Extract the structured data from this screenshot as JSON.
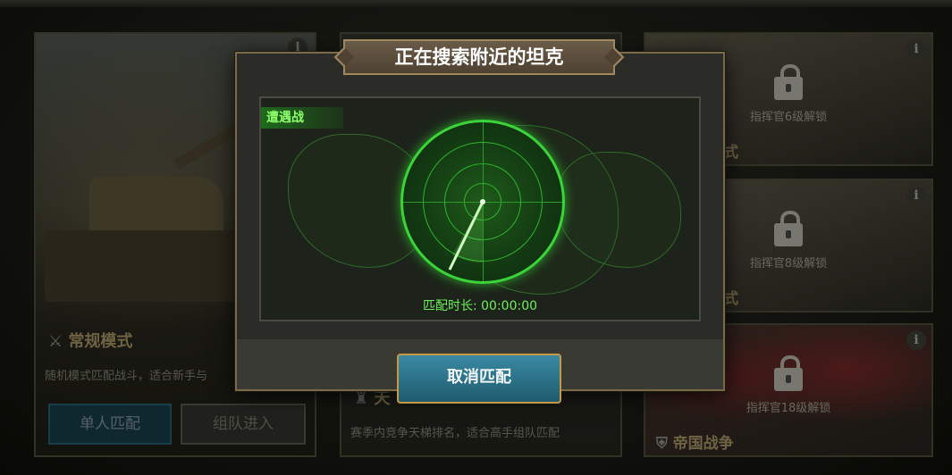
{
  "dialog": {
    "title": "正在搜索附近的坦克",
    "mode_tag": "遭遇战",
    "match_time": "匹配时长: 00:00:00",
    "cancel_label": "取消匹配"
  },
  "cards": {
    "left": {
      "title": "常规模式",
      "desc": "随机模式匹配战斗，适合新手与",
      "solo_label": "单人匹配",
      "team_label": "组队进入"
    },
    "middle": {
      "title": "天",
      "desc": "赛季内竞争天梯排名，适合高手组队匹配"
    },
    "right": [
      {
        "lock_text": "指挥官6级解锁",
        "title": "模式"
      },
      {
        "lock_text": "指挥官8级解锁",
        "title": "模式"
      },
      {
        "lock_text": "指挥官18级解锁",
        "title": "帝国战争"
      }
    ]
  },
  "colors": {
    "radar_green": "#3bd53a",
    "cancel_button": "#2f7a92",
    "title_plate": "#5d4e3c"
  }
}
